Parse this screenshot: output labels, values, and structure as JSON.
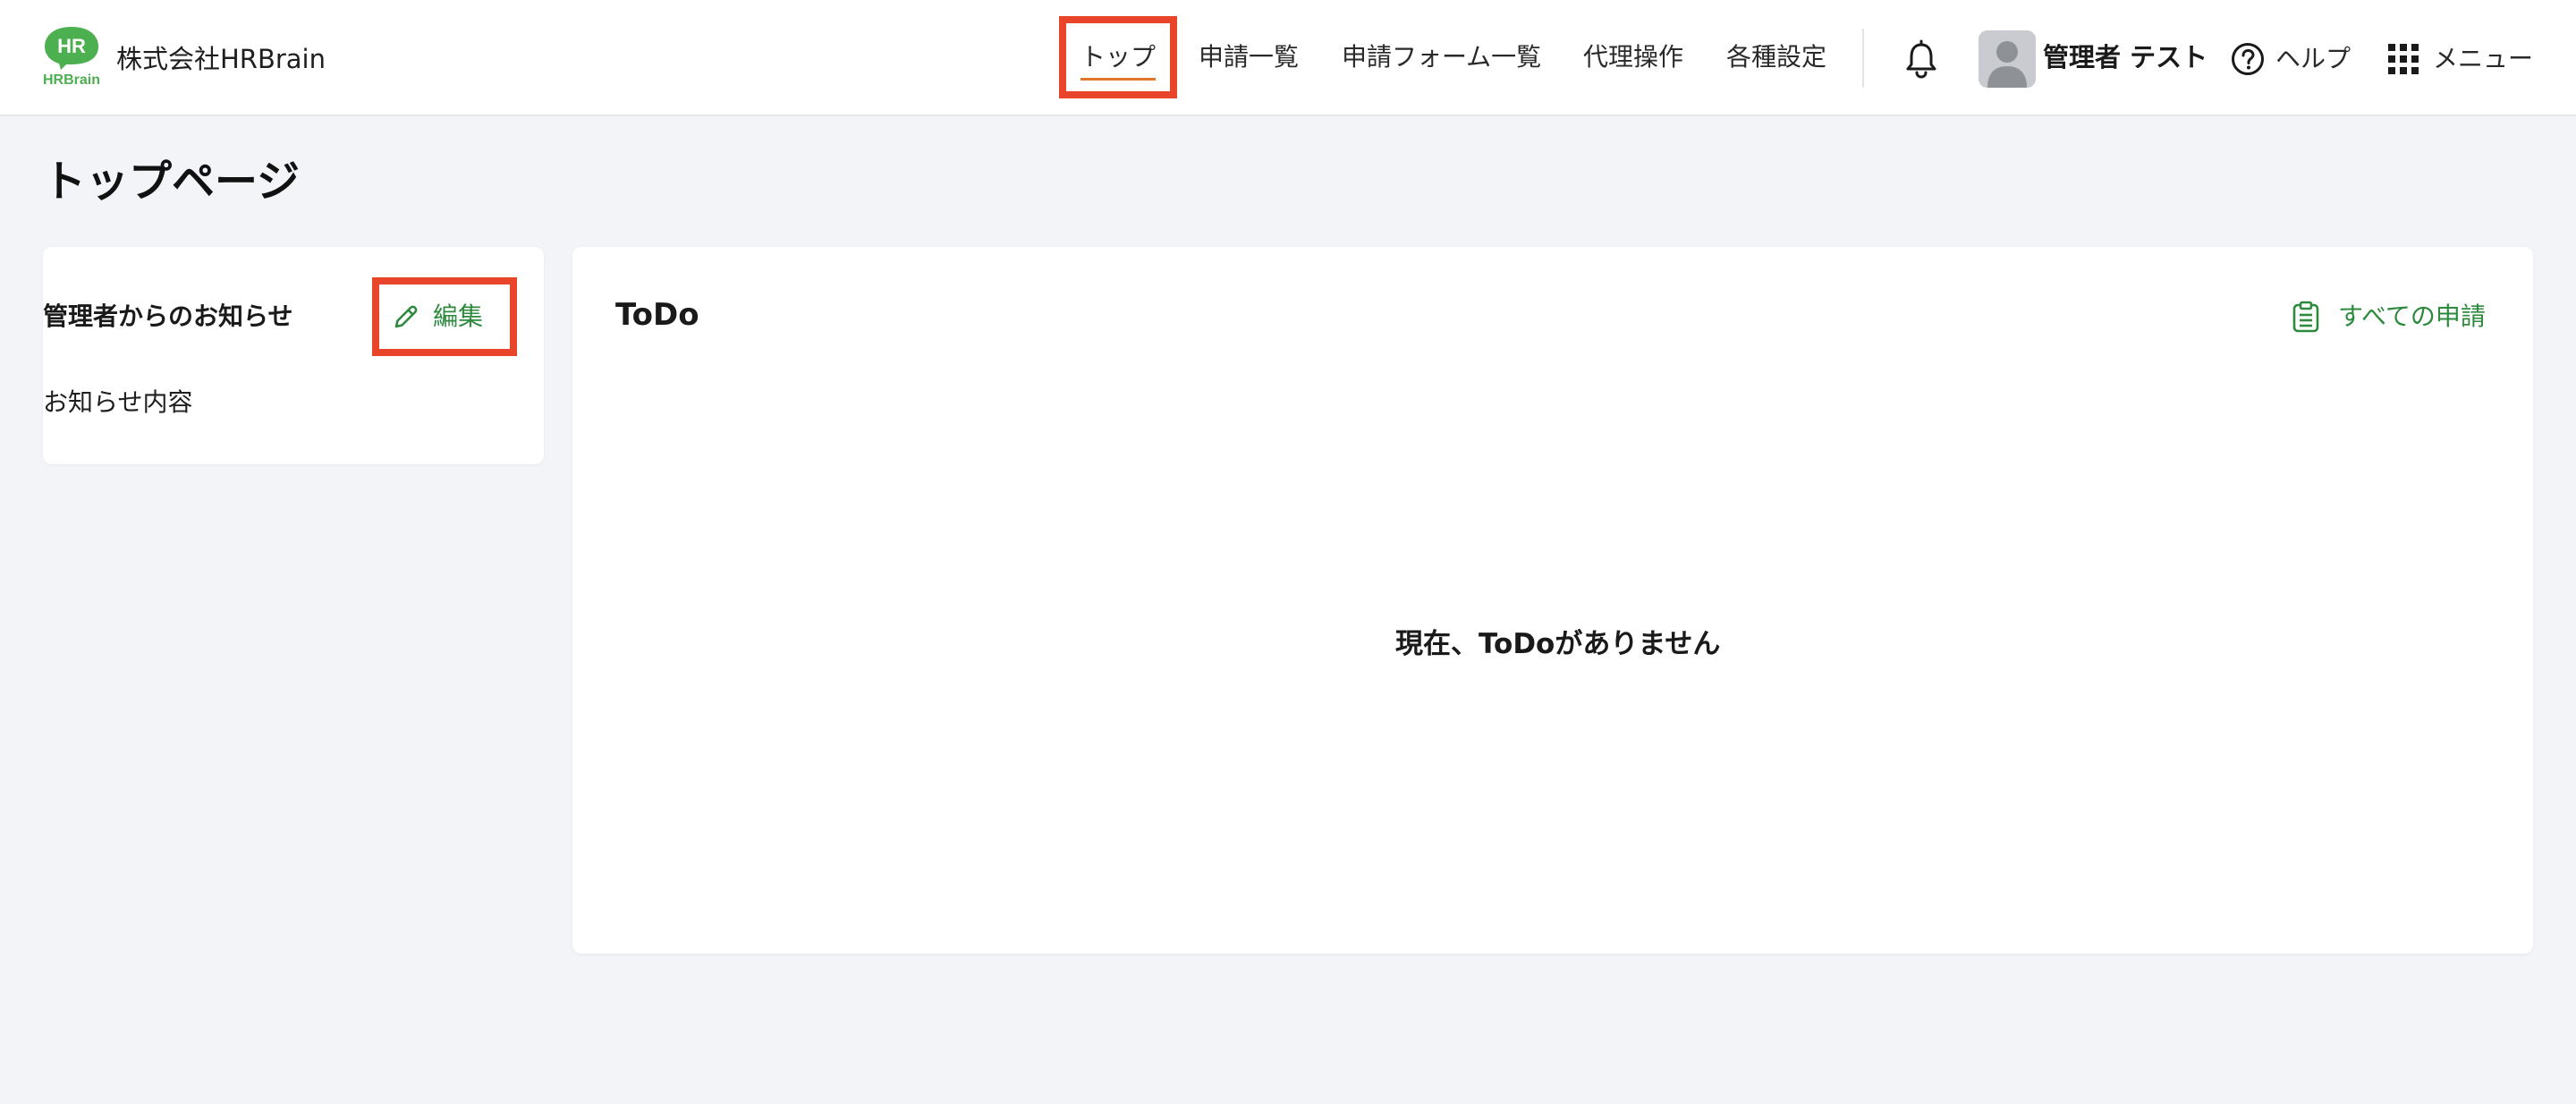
{
  "header": {
    "company_name": "株式会社HRBrain",
    "logo": {
      "top_text": "HR",
      "bottom_text": "HRBrain",
      "color": "#4caf50"
    },
    "nav": [
      {
        "label": "トップ",
        "active": true
      },
      {
        "label": "申請一覧",
        "active": false
      },
      {
        "label": "申請フォーム一覧",
        "active": false
      },
      {
        "label": "代理操作",
        "active": false
      },
      {
        "label": "各種設定",
        "active": false
      }
    ],
    "bell_icon": "bell-icon",
    "user_name": "管理者 テスト",
    "help_label": "ヘルプ",
    "menu_label": "メニュー",
    "active_underline_color": "#e0752c"
  },
  "page": {
    "title": "トップページ"
  },
  "notice": {
    "title": "管理者からのお知らせ",
    "edit_label": "編集",
    "content": "お知らせ内容"
  },
  "todo": {
    "title": "ToDo",
    "all_requests_label": "すべての申請",
    "empty_message": "現在、ToDoがありません"
  },
  "colors": {
    "accent_green": "#2e8a3f",
    "highlight_red": "#e8452b",
    "background": "#f3f4f8"
  }
}
